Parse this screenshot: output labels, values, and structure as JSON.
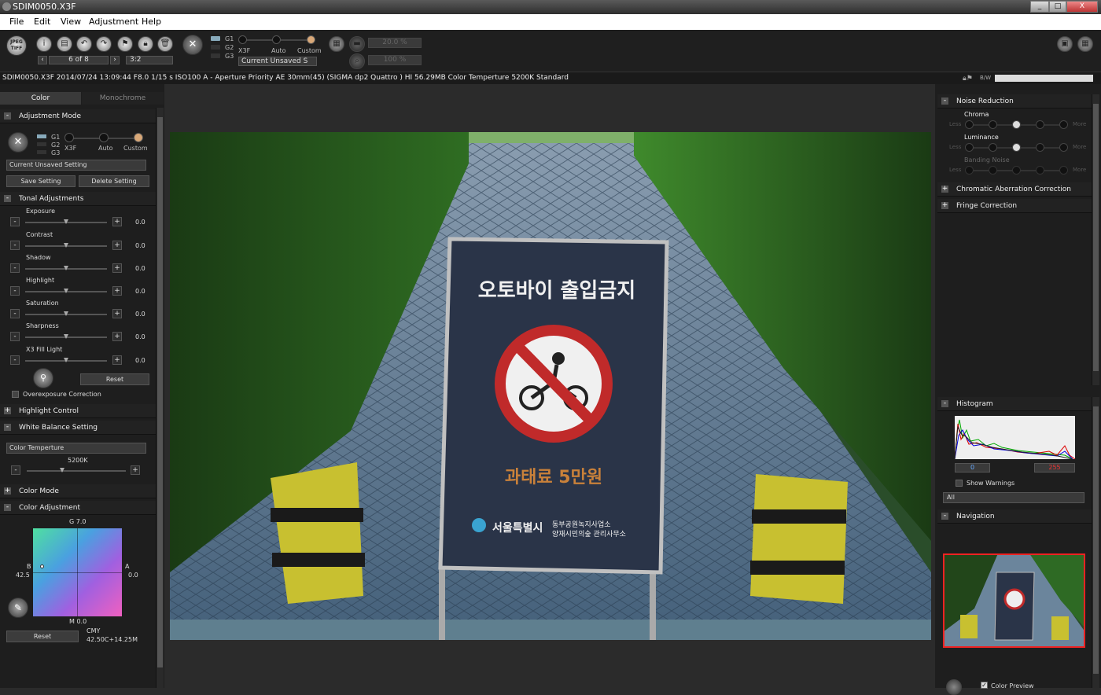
{
  "window": {
    "title": "SDIM0050.X3F",
    "controls": [
      "_",
      "□",
      "X"
    ]
  },
  "menu": [
    "File",
    "Edit",
    "View",
    "Adjustment",
    "Help"
  ],
  "toolbar": {
    "jpeg_tiff": "JPEG TIFF",
    "nav_text": "6 of 8",
    "aspect": "3:2",
    "mode_labels": [
      "X3F",
      "Auto",
      "Custom"
    ],
    "groups": [
      "G1",
      "G2",
      "G3"
    ],
    "setting": "Current Unsaved S",
    "zoom1": "20.0 %",
    "zoom2": "100 %"
  },
  "infobar": {
    "text": "SDIM0050.X3F 2014/07/24 13:09:44 F8.0 1/15 s ISO100 A - Aperture Priority AE 30mm(45) (SIGMA dp2 Quattro ) HI 56.29MB Color Temperture 5200K Standard",
    "bw": "B/W"
  },
  "left": {
    "tabs": [
      "Color",
      "Monochrome"
    ],
    "adjustment_mode": "Adjustment Mode",
    "groups": [
      "G1",
      "G2",
      "G3"
    ],
    "mode_labels": [
      "X3F",
      "Auto",
      "Custom"
    ],
    "current_setting": "Current Unsaved Setting",
    "save_setting": "Save Setting",
    "delete_setting": "Delete Setting",
    "tonal": "Tonal Adjustments",
    "sliders": [
      {
        "label": "Exposure",
        "value": "0.0"
      },
      {
        "label": "Contrast",
        "value": "0.0"
      },
      {
        "label": "Shadow",
        "value": "0.0"
      },
      {
        "label": "Highlight",
        "value": "0.0"
      },
      {
        "label": "Saturation",
        "value": "0.0"
      },
      {
        "label": "Sharpness",
        "value": "0.0"
      },
      {
        "label": "X3 Fill Light",
        "value": "0.0"
      }
    ],
    "reset": "Reset",
    "overexposure": "Overexposure Correction",
    "highlight_control": "Highlight Control",
    "wb_setting": "White Balance Setting",
    "wb_select": "Color Temperture",
    "wb_value": "5200K",
    "color_mode": "Color Mode",
    "color_adjustment": "Color Adjustment",
    "g_label": "G 7.0",
    "b_label": "B",
    "b_value": "42.5",
    "a_label": "A",
    "a_value": "0.0",
    "m_label": "M 0.0",
    "reset2": "Reset",
    "cmy_label": "CMY",
    "cmy_value": "42.50C+14.25M"
  },
  "photo": {
    "sign_title": "오토바이 출입금지",
    "sign_fine": "과태료 5만원",
    "city": "서울특별시",
    "office1": "동부공원녹지사업소",
    "office2": "양재시민의숲 관리사무소"
  },
  "right": {
    "noise_reduction": "Noise Reduction",
    "chroma": "Chroma",
    "luminance": "Luminance",
    "banding": "Banding Noise",
    "less": "Less",
    "more": "More",
    "chromatic": "Chromatic Aberration Correction",
    "fringe": "Fringe Correction",
    "histogram": "Histogram",
    "hist_low": "0",
    "hist_high": "255",
    "show_warnings": "Show Warnings",
    "channel": "All",
    "navigation": "Navigation",
    "color_preview": "Color Preview"
  }
}
